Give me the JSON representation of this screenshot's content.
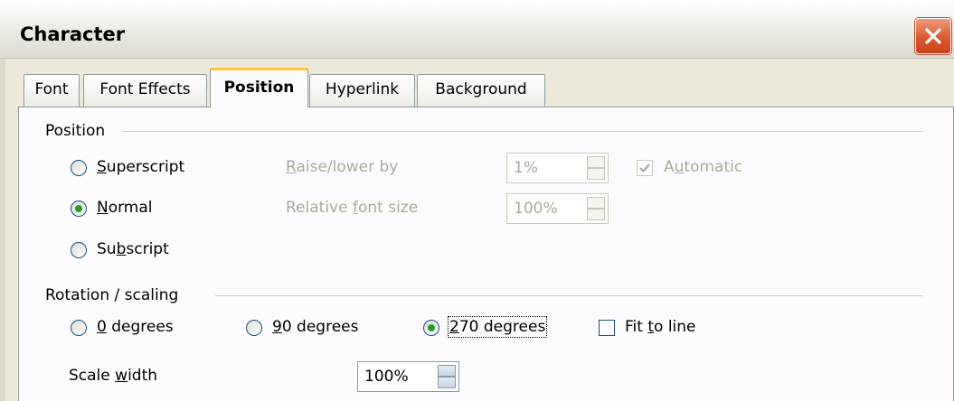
{
  "window": {
    "title": "Character"
  },
  "tabs": [
    "Font",
    "Font Effects",
    "Position",
    "Hyperlink",
    "Background"
  ],
  "active_tab": "Position",
  "position_group": {
    "label": "Position",
    "options": {
      "superscript": {
        "pre": "",
        "mnemonic": "S",
        "post": "uperscript",
        "selected": false
      },
      "normal": {
        "pre": "",
        "mnemonic": "N",
        "post": "ormal",
        "selected": true
      },
      "subscript": {
        "pre": "Su",
        "mnemonic": "b",
        "post": "script",
        "selected": false
      }
    },
    "raise_lower": {
      "pre": "",
      "mnemonic": "R",
      "post": "aise/lower by",
      "value": "1%"
    },
    "automatic": {
      "pre": "A",
      "mnemonic": "u",
      "post": "tomatic",
      "checked": true
    },
    "relative_size": {
      "pre": "Relative ",
      "mnemonic": "f",
      "post": "ont size",
      "value": "100%"
    }
  },
  "rotation_group": {
    "label": "Rotation / scaling",
    "deg0": {
      "pre": "",
      "mnemonic": "0",
      "post": " degrees",
      "selected": false
    },
    "deg90": {
      "pre": "",
      "mnemonic": "9",
      "post": "0 degrees",
      "selected": false
    },
    "deg270": {
      "pre": "",
      "mnemonic": "2",
      "post": "70 degrees",
      "selected": true
    },
    "fit_to_line": {
      "pre": "Fit ",
      "mnemonic": "t",
      "post": "o line",
      "checked": false
    },
    "scale_width": {
      "pre": "Scale ",
      "mnemonic": "w",
      "post": "idth",
      "value": "100%"
    }
  }
}
